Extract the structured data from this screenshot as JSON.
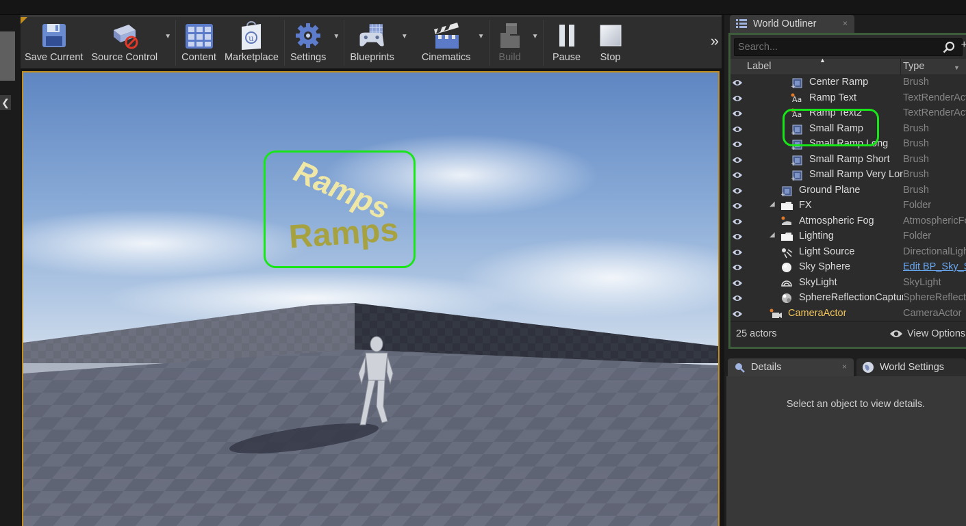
{
  "toolbar": {
    "buttons": [
      {
        "label": "Save Current",
        "icon": "floppy-disk-icon"
      },
      {
        "label": "Source Control",
        "icon": "source-control-icon"
      },
      {
        "label": "Content",
        "icon": "content-grid-icon"
      },
      {
        "label": "Marketplace",
        "icon": "marketplace-bag-icon"
      },
      {
        "label": "Settings",
        "icon": "gear-icon"
      },
      {
        "label": "Blueprints",
        "icon": "gamepad-icon"
      },
      {
        "label": "Cinematics",
        "icon": "clapperboard-icon"
      },
      {
        "label": "Build",
        "icon": "build-blocks-icon",
        "disabled": true
      },
      {
        "label": "Pause",
        "icon": "pause-icon"
      },
      {
        "label": "Stop",
        "icon": "stop-icon"
      }
    ],
    "more_glyph": "»"
  },
  "left_strip": {
    "collapse_glyph": "❮"
  },
  "viewport": {
    "text_actor_1": "Ramps",
    "text_actor_2": "Ramps",
    "highlight_color": "#19e619"
  },
  "outliner": {
    "tab_label": "World Outliner",
    "tab_close": "×",
    "search_placeholder": "Search...",
    "add_glyph": "+",
    "col_label": "Label",
    "col_type": "Type",
    "rows": [
      {
        "name": "Center Ramp",
        "type": "Brush",
        "icon": "brush-icon",
        "depth": 2
      },
      {
        "name": "Ramp Text",
        "type": "TextRenderActor",
        "icon": "text-render-icon",
        "depth": 2
      },
      {
        "name": "Ramp Text2",
        "type": "TextRenderActor",
        "icon": "text-render-icon",
        "depth": 2
      },
      {
        "name": "Small Ramp",
        "type": "Brush",
        "icon": "brush-icon",
        "depth": 2
      },
      {
        "name": "Small Ramp Long",
        "type": "Brush",
        "icon": "brush-icon",
        "depth": 2
      },
      {
        "name": "Small Ramp Short",
        "type": "Brush",
        "icon": "brush-icon",
        "depth": 2
      },
      {
        "name": "Small Ramp Very Long",
        "type": "Brush",
        "icon": "brush-icon",
        "depth": 2
      },
      {
        "name": "Ground Plane",
        "type": "Brush",
        "icon": "brush-icon",
        "depth": 1
      },
      {
        "name": "FX",
        "type": "Folder",
        "icon": "folder-icon",
        "depth": 1,
        "expanded": true
      },
      {
        "name": "Atmospheric Fog",
        "type": "AtmosphericFog",
        "icon": "atmospheric-fog-icon",
        "depth": 1
      },
      {
        "name": "Lighting",
        "type": "Folder",
        "icon": "folder-icon",
        "depth": 1,
        "expanded": true
      },
      {
        "name": "Light Source",
        "type": "DirectionalLight",
        "icon": "directional-light-icon",
        "depth": 1
      },
      {
        "name": "Sky Sphere",
        "type": "Edit BP_Sky_Sphere",
        "icon": "sphere-icon",
        "depth": 1,
        "link": true
      },
      {
        "name": "SkyLight",
        "type": "SkyLight",
        "icon": "skylight-icon",
        "depth": 1
      },
      {
        "name": "SphereReflectionCapture",
        "type": "SphereReflectionCapture",
        "icon": "reflection-capture-icon",
        "depth": 1
      },
      {
        "name": "CameraActor",
        "type": "CameraActor",
        "icon": "camera-icon",
        "depth": 0,
        "camera": true
      }
    ],
    "actor_count": "25 actors",
    "view_options": "View Options"
  },
  "details": {
    "tab_label": "Details",
    "tab_close": "×",
    "world_settings_label": "World Settings",
    "empty_message": "Select an object to view details."
  }
}
